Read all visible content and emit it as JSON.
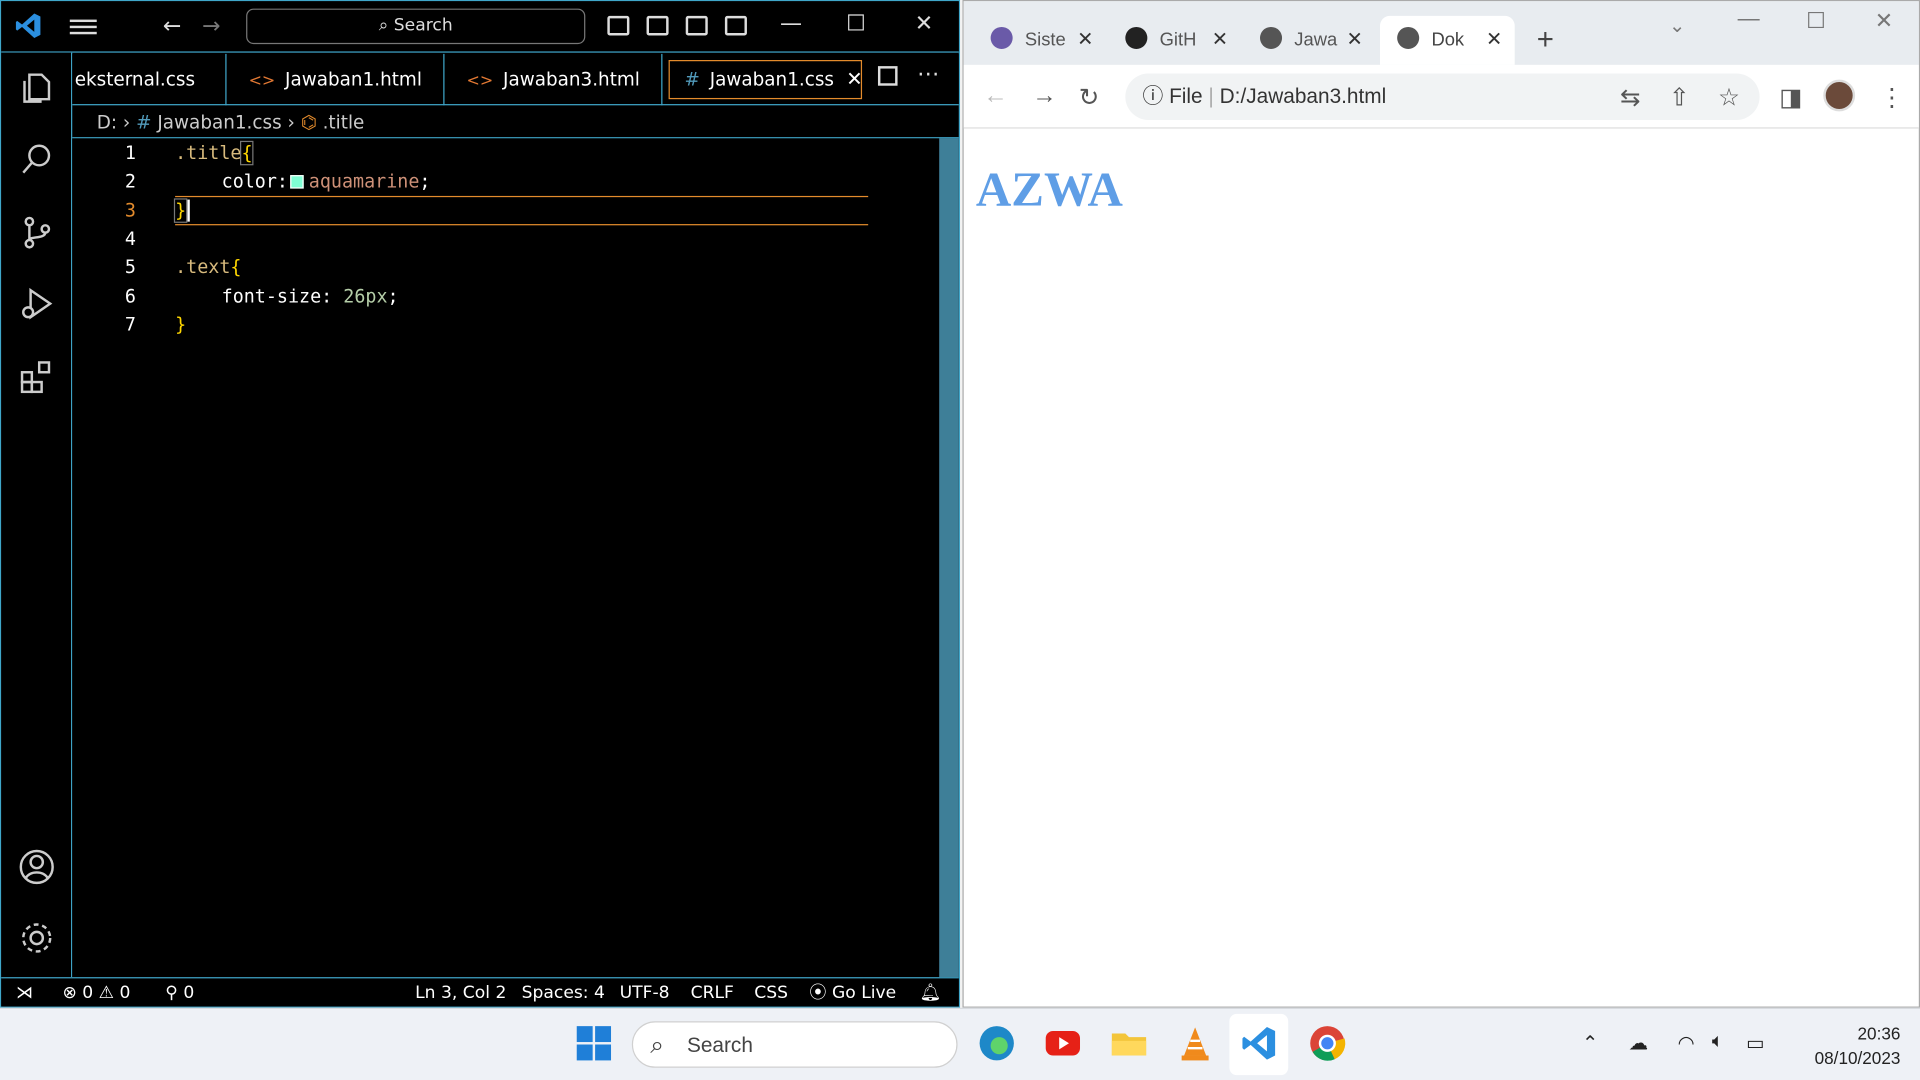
{
  "vscode": {
    "search_label": "Search",
    "tabs": [
      {
        "label": "eksternal.css"
      },
      {
        "label": "Jawaban1.html"
      },
      {
        "label": "Jawaban3.html"
      },
      {
        "label": "Jawaban1.css"
      }
    ],
    "breadcrumb": {
      "drive": "D:",
      "file": "Jawaban1.css",
      "symbol": ".title"
    },
    "line_numbers": [
      "1",
      "2",
      "3",
      "4",
      "5",
      "6",
      "7"
    ],
    "code": {
      "l1_selector": ".title",
      "l2_prop": "color:",
      "l2_value": "aquamarine",
      "l5_selector": ".text",
      "l6_prop": "font-size:",
      "l6_value": "26px"
    },
    "status": {
      "errors": "0",
      "warnings": "0",
      "ports": "0",
      "position": "Ln 3, Col 2",
      "spaces": "Spaces: 4",
      "encoding": "UTF-8",
      "eol": "CRLF",
      "language": "CSS",
      "go_live": "Go Live"
    },
    "colors": {
      "accent": "#3fa6c9",
      "active_tab": "#e38b2c",
      "swatch": "#7fffd4"
    }
  },
  "browser": {
    "tabs": [
      {
        "label": "Siste"
      },
      {
        "label": "GitH"
      },
      {
        "label": "Jawa"
      },
      {
        "label": "Dok"
      }
    ],
    "address_scheme": "File",
    "address": "D:/Jawaban3.html",
    "page_heading": "AZWA",
    "heading_color": "#5f9ee6"
  },
  "taskbar": {
    "search_label": "Search",
    "time": "20:36",
    "date": "08/10/2023"
  }
}
